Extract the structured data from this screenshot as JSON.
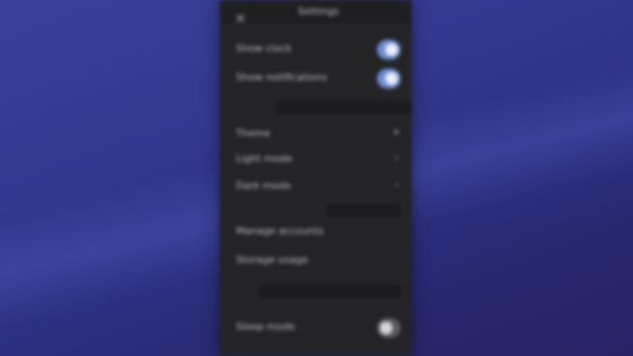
{
  "window": {
    "title": "Settings"
  },
  "header": {
    "close_glyph": "✕",
    "icon": "close-icon"
  },
  "general": {
    "rows": [
      {
        "label": "Show clock",
        "toggle_on": true
      },
      {
        "label": "Show notifications",
        "toggle_on": true
      }
    ]
  },
  "display": {
    "heading": "Theme",
    "options": [
      {
        "label": "Light mode",
        "chevron": "›"
      },
      {
        "label": "Dark mode",
        "chevron": "›"
      }
    ]
  },
  "links": {
    "items": [
      {
        "label": "Manage accounts"
      },
      {
        "label": "Storage usage"
      }
    ]
  },
  "footer": {
    "label": "Sleep mode",
    "toggle_on": false
  },
  "colors": {
    "accent": "#6c8fd2",
    "panel": "#242426",
    "background": "#34388f"
  }
}
